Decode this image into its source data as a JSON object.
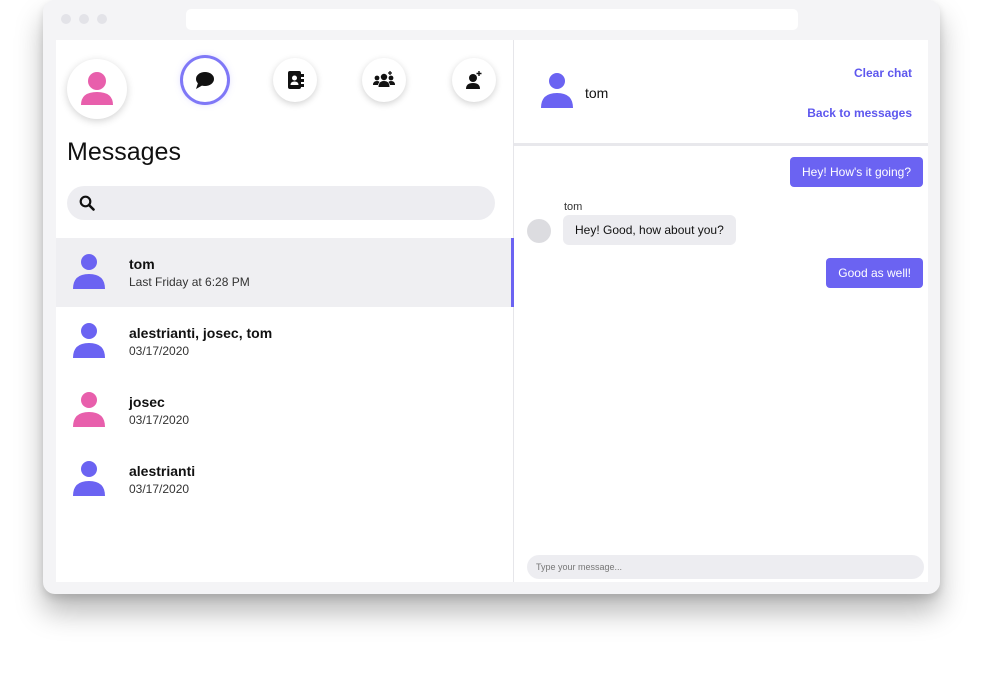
{
  "window": {
    "controls": [
      "close",
      "minimize",
      "maximize"
    ]
  },
  "colors": {
    "accent": "#6b63f2",
    "user_pink": "#e85fac",
    "user_blue": "#6b63f2"
  },
  "nav": {
    "items": [
      {
        "name": "chat",
        "icon": "chat-bubble-icon",
        "active": true
      },
      {
        "name": "contacts",
        "icon": "address-book-icon",
        "active": false
      },
      {
        "name": "groups",
        "icon": "users-icon",
        "active": false
      },
      {
        "name": "add-contact",
        "icon": "user-plus-icon",
        "active": false
      }
    ]
  },
  "sidebar": {
    "title": "Messages",
    "search": {
      "placeholder": "",
      "icon": "search-icon"
    },
    "conversations": [
      {
        "name": "tom",
        "meta": "Last Friday at 6:28 PM",
        "avatar_color": "blue",
        "active": true
      },
      {
        "name": "alestrianti, josec, tom",
        "meta": "03/17/2020",
        "avatar_color": "blue",
        "active": false
      },
      {
        "name": "josec",
        "meta": "03/17/2020",
        "avatar_color": "pink",
        "active": false
      },
      {
        "name": "alestrianti",
        "meta": "03/17/2020",
        "avatar_color": "blue",
        "active": false
      }
    ]
  },
  "chat": {
    "contact_name": "tom",
    "clear_label": "Clear chat",
    "back_label": "Back to messages",
    "messages": [
      {
        "from": "me",
        "text": "Hey! How's it going?"
      },
      {
        "from": "tom",
        "sender": "tom",
        "text": "Hey! Good, how about you?"
      },
      {
        "from": "me",
        "text": "Good as well!"
      }
    ],
    "composer_placeholder": "Type your message..."
  }
}
